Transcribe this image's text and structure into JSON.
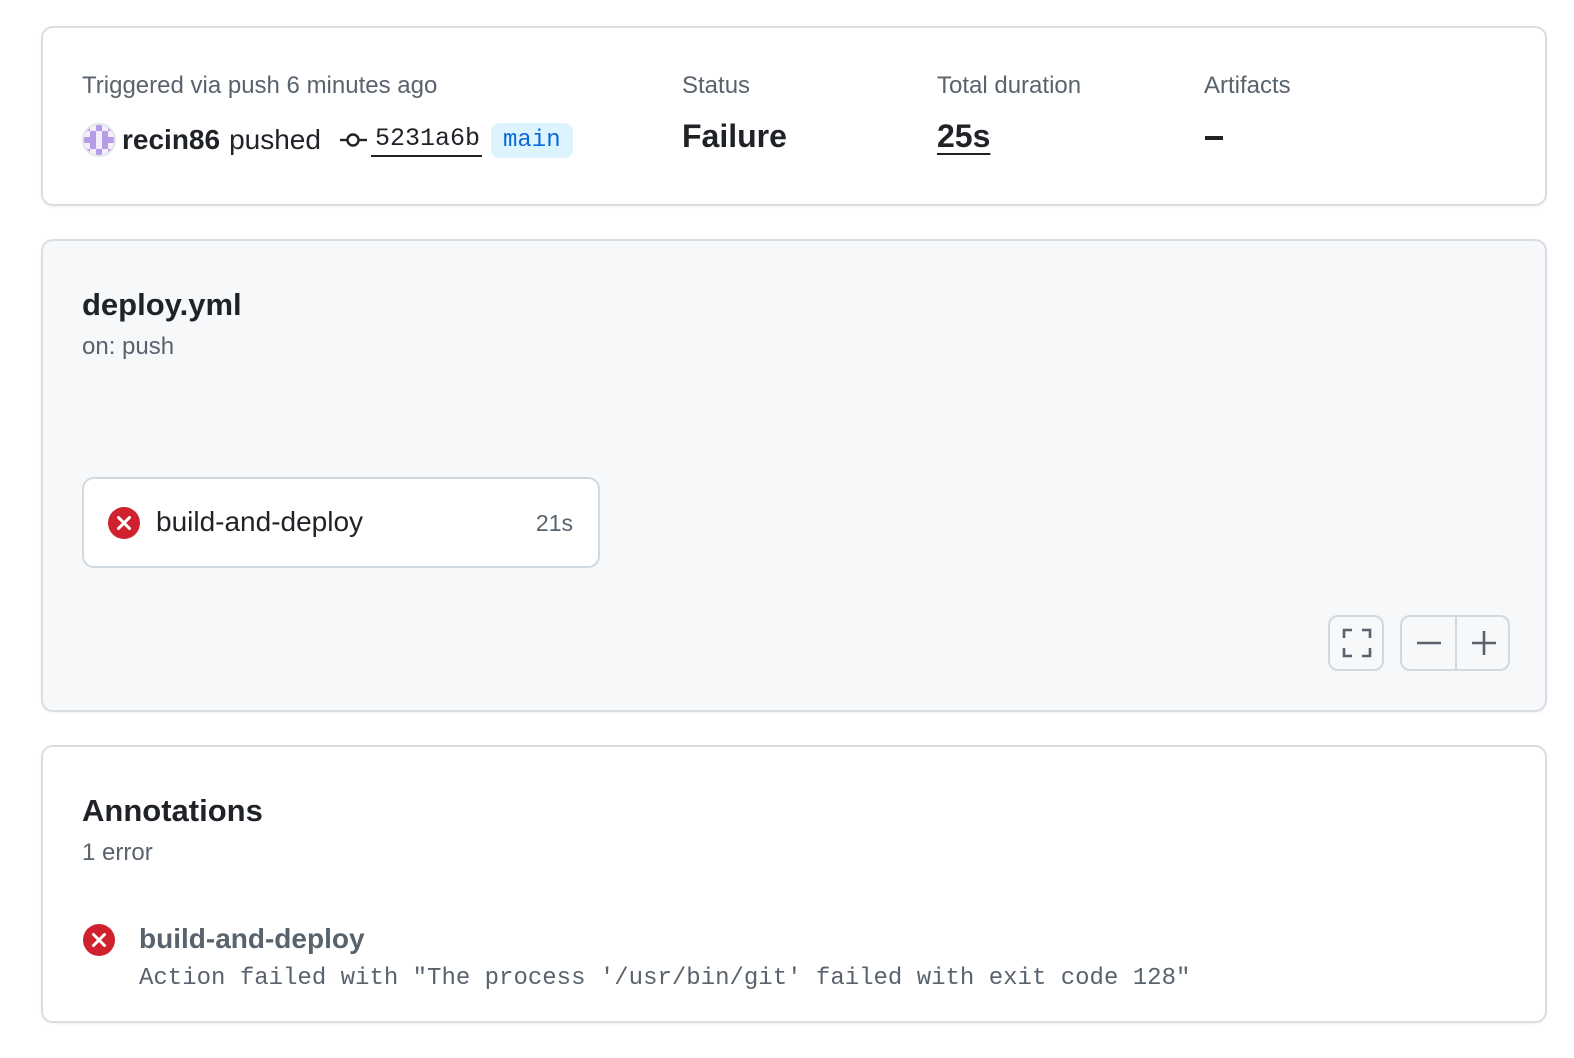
{
  "summary": {
    "trigger_text": "Triggered via push 6 minutes ago",
    "actor": "recin86",
    "action": "pushed",
    "commit_sha": "5231a6b",
    "branch": "main",
    "status_label": "Status",
    "status_value": "Failure",
    "duration_label": "Total duration",
    "duration_value": "25s",
    "artifacts_label": "Artifacts",
    "artifacts_value": "–"
  },
  "workflow": {
    "file_name": "deploy.yml",
    "trigger": "on: push",
    "jobs": [
      {
        "name": "build-and-deploy",
        "duration": "21s",
        "status": "failure",
        "status_icon": "x-circle-fill-icon"
      }
    ],
    "controls": {
      "fullscreen_icon": "fullscreen-icon",
      "zoom_out_icon": "minus-icon",
      "zoom_in_icon": "plus-icon"
    }
  },
  "annotations": {
    "title": "Annotations",
    "count_text": "1 error",
    "items": [
      {
        "job": "build-and-deploy",
        "message": "Action failed with \"The process '/usr/bin/git' failed with exit code 128\"",
        "severity": "error",
        "icon": "x-circle-fill-icon"
      }
    ]
  },
  "colors": {
    "failure_red": "#cf222e",
    "branch_bg": "#ddf4ff",
    "branch_fg": "#0969da",
    "muted_text": "#59636e",
    "border": "#d8dee4"
  }
}
